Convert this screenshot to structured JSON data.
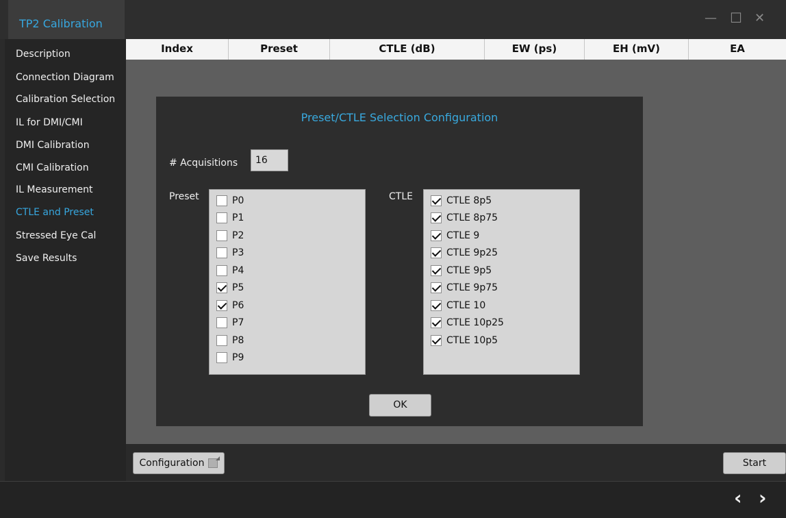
{
  "window": {
    "title": "TP2 Calibration",
    "minimize_glyph": "—",
    "maximize_glyph": "☐",
    "close_glyph": "✕"
  },
  "sidebar": {
    "items": [
      {
        "label": "Description"
      },
      {
        "label": "Connection Diagram"
      },
      {
        "label": "Calibration Selection"
      },
      {
        "label": "IL for DMI/CMI"
      },
      {
        "label": "DMI Calibration"
      },
      {
        "label": "CMI Calibration"
      },
      {
        "label": "IL Measurement"
      },
      {
        "label": "CTLE and Preset",
        "active": true
      },
      {
        "label": "Stressed Eye Cal"
      },
      {
        "label": "Save Results"
      }
    ]
  },
  "table": {
    "columns": [
      "Index",
      "Preset",
      "CTLE (dB)",
      "EW (ps)",
      "EH (mV)",
      "EA"
    ]
  },
  "dialog": {
    "title": "Preset/CTLE Selection Configuration",
    "acquisitions_label": "# Acquisitions",
    "acquisitions_value": "16",
    "preset_label": "Preset",
    "ctle_label": "CTLE",
    "presets": [
      {
        "label": "P0",
        "checked": false
      },
      {
        "label": "P1",
        "checked": false
      },
      {
        "label": "P2",
        "checked": false
      },
      {
        "label": "P3",
        "checked": false
      },
      {
        "label": "P4",
        "checked": false
      },
      {
        "label": "P5",
        "checked": true
      },
      {
        "label": "P6",
        "checked": true
      },
      {
        "label": "P7",
        "checked": false
      },
      {
        "label": "P8",
        "checked": false
      },
      {
        "label": "P9",
        "checked": false
      }
    ],
    "ctles": [
      {
        "label": "CTLE 8p5",
        "checked": true
      },
      {
        "label": "CTLE 8p75",
        "checked": true
      },
      {
        "label": "CTLE 9",
        "checked": true
      },
      {
        "label": "CTLE 9p25",
        "checked": true
      },
      {
        "label": "CTLE 9p5",
        "checked": true
      },
      {
        "label": "CTLE 9p75",
        "checked": true
      },
      {
        "label": "CTLE 10",
        "checked": true
      },
      {
        "label": "CTLE 10p25",
        "checked": true
      },
      {
        "label": "CTLE 10p5",
        "checked": true
      }
    ],
    "ok_label": "OK"
  },
  "bottom": {
    "configuration_label": "Configuration",
    "start_label": "Start"
  },
  "footer": {
    "back_glyph": "‹",
    "forward_glyph": "›"
  },
  "colors": {
    "accent": "#37a7df",
    "background": "#2b2b2b",
    "panel": "#5e5e5e"
  }
}
